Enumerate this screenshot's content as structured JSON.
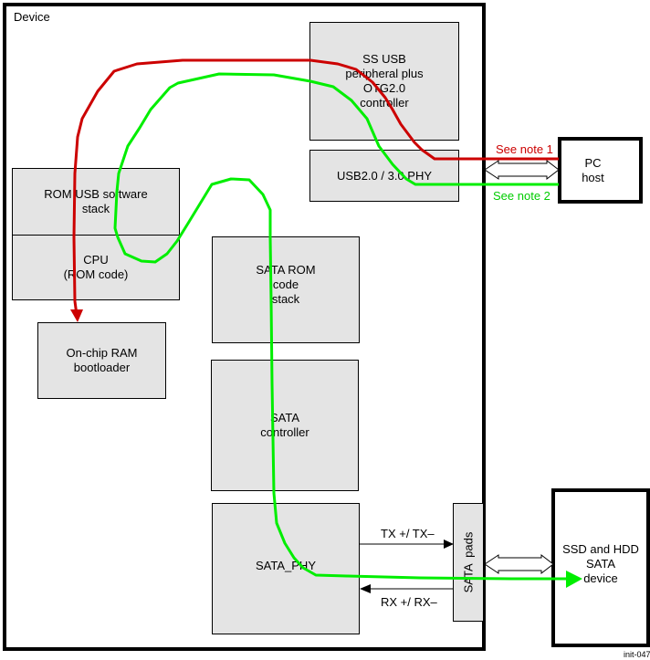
{
  "diagram": {
    "title": "Device",
    "figure_id": "init-047",
    "blocks": {
      "ss_usb": "SS USB\nperipheral plus\nOTG2.0\ncontroller",
      "usb_phy": "USB2.0 / 3.0 PHY",
      "rom_usb": "ROM USB software\nstack",
      "cpu": "CPU\n(ROM code)",
      "onchip_ram": "On-chip RAM\nbootloader",
      "sata_rom": "SATA ROM\ncode\nstack",
      "sata_controller": "SATA\ncontroller",
      "sata_phy": "SATA_PHY",
      "sata_pads": "SATA  pads"
    },
    "external": {
      "pc_host": "PC\nhost",
      "sata_device": "SSD and HDD\nSATA\ndevice"
    },
    "notes": {
      "note1": "See note 1",
      "note2": "See note 2"
    },
    "signals": {
      "tx": "TX +/ TX–",
      "rx": "RX +/ RX–"
    },
    "paths": [
      {
        "name": "usb-boot-path",
        "color": "#cc0000",
        "from": "PC host",
        "to": "On-chip RAM bootloader",
        "note": "See note 1"
      },
      {
        "name": "sata-boot-path",
        "color": "#00ee00",
        "from": "PC host",
        "to": "SSD and HDD SATA device",
        "note": "See note 2"
      }
    ]
  }
}
